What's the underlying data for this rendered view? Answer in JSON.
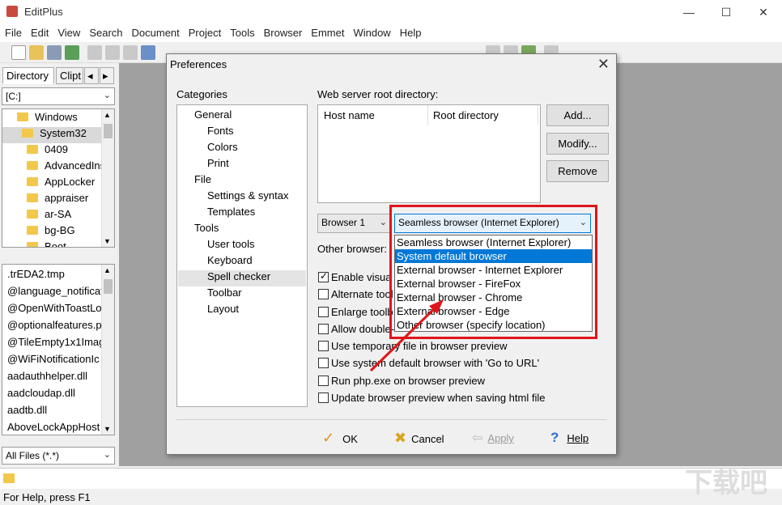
{
  "window": {
    "title": "EditPlus"
  },
  "menu": [
    "File",
    "Edit",
    "View",
    "Search",
    "Document",
    "Project",
    "Tools",
    "Browser",
    "Emmet",
    "Window",
    "Help"
  ],
  "left_panel": {
    "tabs": [
      "Directory",
      "Clipt"
    ],
    "drive": "[C:]",
    "tree": [
      "Windows",
      "System32",
      "0409",
      "AdvancedIns",
      "AppLocker",
      "appraiser",
      "ar-SA",
      "bg-BG",
      "Boot"
    ],
    "files": [
      ".trEDA2.tmp",
      "@language_notificat",
      "@OpenWithToastLo",
      "@optionalfeatures.p",
      "@TileEmpty1x1Imag",
      "@WiFiNotificationIc",
      "aadauthhelper.dll",
      "aadcloudap.dll",
      "aadtb.dll",
      "AboveLockAppHost"
    ],
    "filter": "All Files (*.*)"
  },
  "status": {
    "text": "For Help, press F1"
  },
  "dialog": {
    "title": "Preferences",
    "categories_label": "Categories",
    "categories": [
      {
        "label": "General",
        "level": 0
      },
      {
        "label": "Fonts",
        "level": 1
      },
      {
        "label": "Colors",
        "level": 1
      },
      {
        "label": "Print",
        "level": 1
      },
      {
        "label": "File",
        "level": 0
      },
      {
        "label": "Settings & syntax",
        "level": 1
      },
      {
        "label": "Templates",
        "level": 1
      },
      {
        "label": "Tools",
        "level": 0
      },
      {
        "label": "User tools",
        "level": 1
      },
      {
        "label": "Keyboard",
        "level": 1
      },
      {
        "label": "Spell checker",
        "level": 1
      },
      {
        "label": "Toolbar",
        "level": 1
      },
      {
        "label": "Layout",
        "level": 1
      }
    ],
    "selected_category": "Tools",
    "web_root_label": "Web server root directory:",
    "columns": [
      "Host name",
      "Root directory"
    ],
    "add": "Add...",
    "modify": "Modify...",
    "remove": "Remove",
    "browser_select": "Browser 1",
    "browser_combo": "Seamless browser (Internet Explorer)",
    "other_browser_label": "Other browser:",
    "checkboxes": [
      {
        "label": "Enable visua",
        "checked": true
      },
      {
        "label": "Alternate tool",
        "checked": false
      },
      {
        "label": "Enlarge toolb",
        "checked": false
      },
      {
        "label": "Allow double-",
        "checked": false
      },
      {
        "label": "Use temporary file in browser preview",
        "checked": false
      },
      {
        "label": "Use system default browser with 'Go to URL'",
        "checked": false
      },
      {
        "label": "Run php.exe on browser preview",
        "checked": false
      },
      {
        "label": "Update browser preview when saving html file",
        "checked": false
      }
    ],
    "ok": "OK",
    "cancel": "Cancel",
    "apply": "Apply",
    "help": "Help",
    "dropdown_options": [
      "Seamless browser (Internet Explorer)",
      "System default browser",
      "External browser - Internet Explorer",
      "External browser - FireFox",
      "External browser - Chrome",
      "External browser - Edge",
      "Other browser (specify location)"
    ],
    "dropdown_selected_index": 1
  },
  "colors": {
    "accent": "#0078d7",
    "highlight_box": "#e0151b",
    "folder": "#f2c84b"
  }
}
